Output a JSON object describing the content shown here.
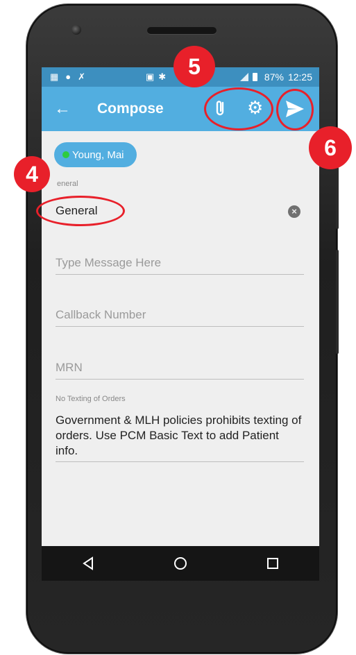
{
  "status_bar": {
    "battery": "87%",
    "time": "12:25"
  },
  "app_bar": {
    "title": "Compose",
    "back_icon": "arrow-left-icon",
    "attach_icon": "paperclip-icon",
    "settings_icon": "gear-icon",
    "send_icon": "send-icon"
  },
  "recipient": {
    "name": "Young, Mai",
    "presence_color": "#2ecc40"
  },
  "subject": {
    "label": "eneral",
    "value": "General"
  },
  "message": {
    "placeholder": "Type Message Here"
  },
  "callback": {
    "placeholder": "Callback Number"
  },
  "mrn": {
    "placeholder": "MRN"
  },
  "notice": {
    "label": "No Texting of Orders",
    "text": "Government & MLH policies prohibits texting of orders.  Use PCM Basic Text to add Patient info."
  },
  "callouts": [
    "4",
    "5",
    "6"
  ],
  "colors": {
    "appbar": "#52aee0",
    "statusbar": "#3d8fbf",
    "callout": "#e8202a"
  }
}
